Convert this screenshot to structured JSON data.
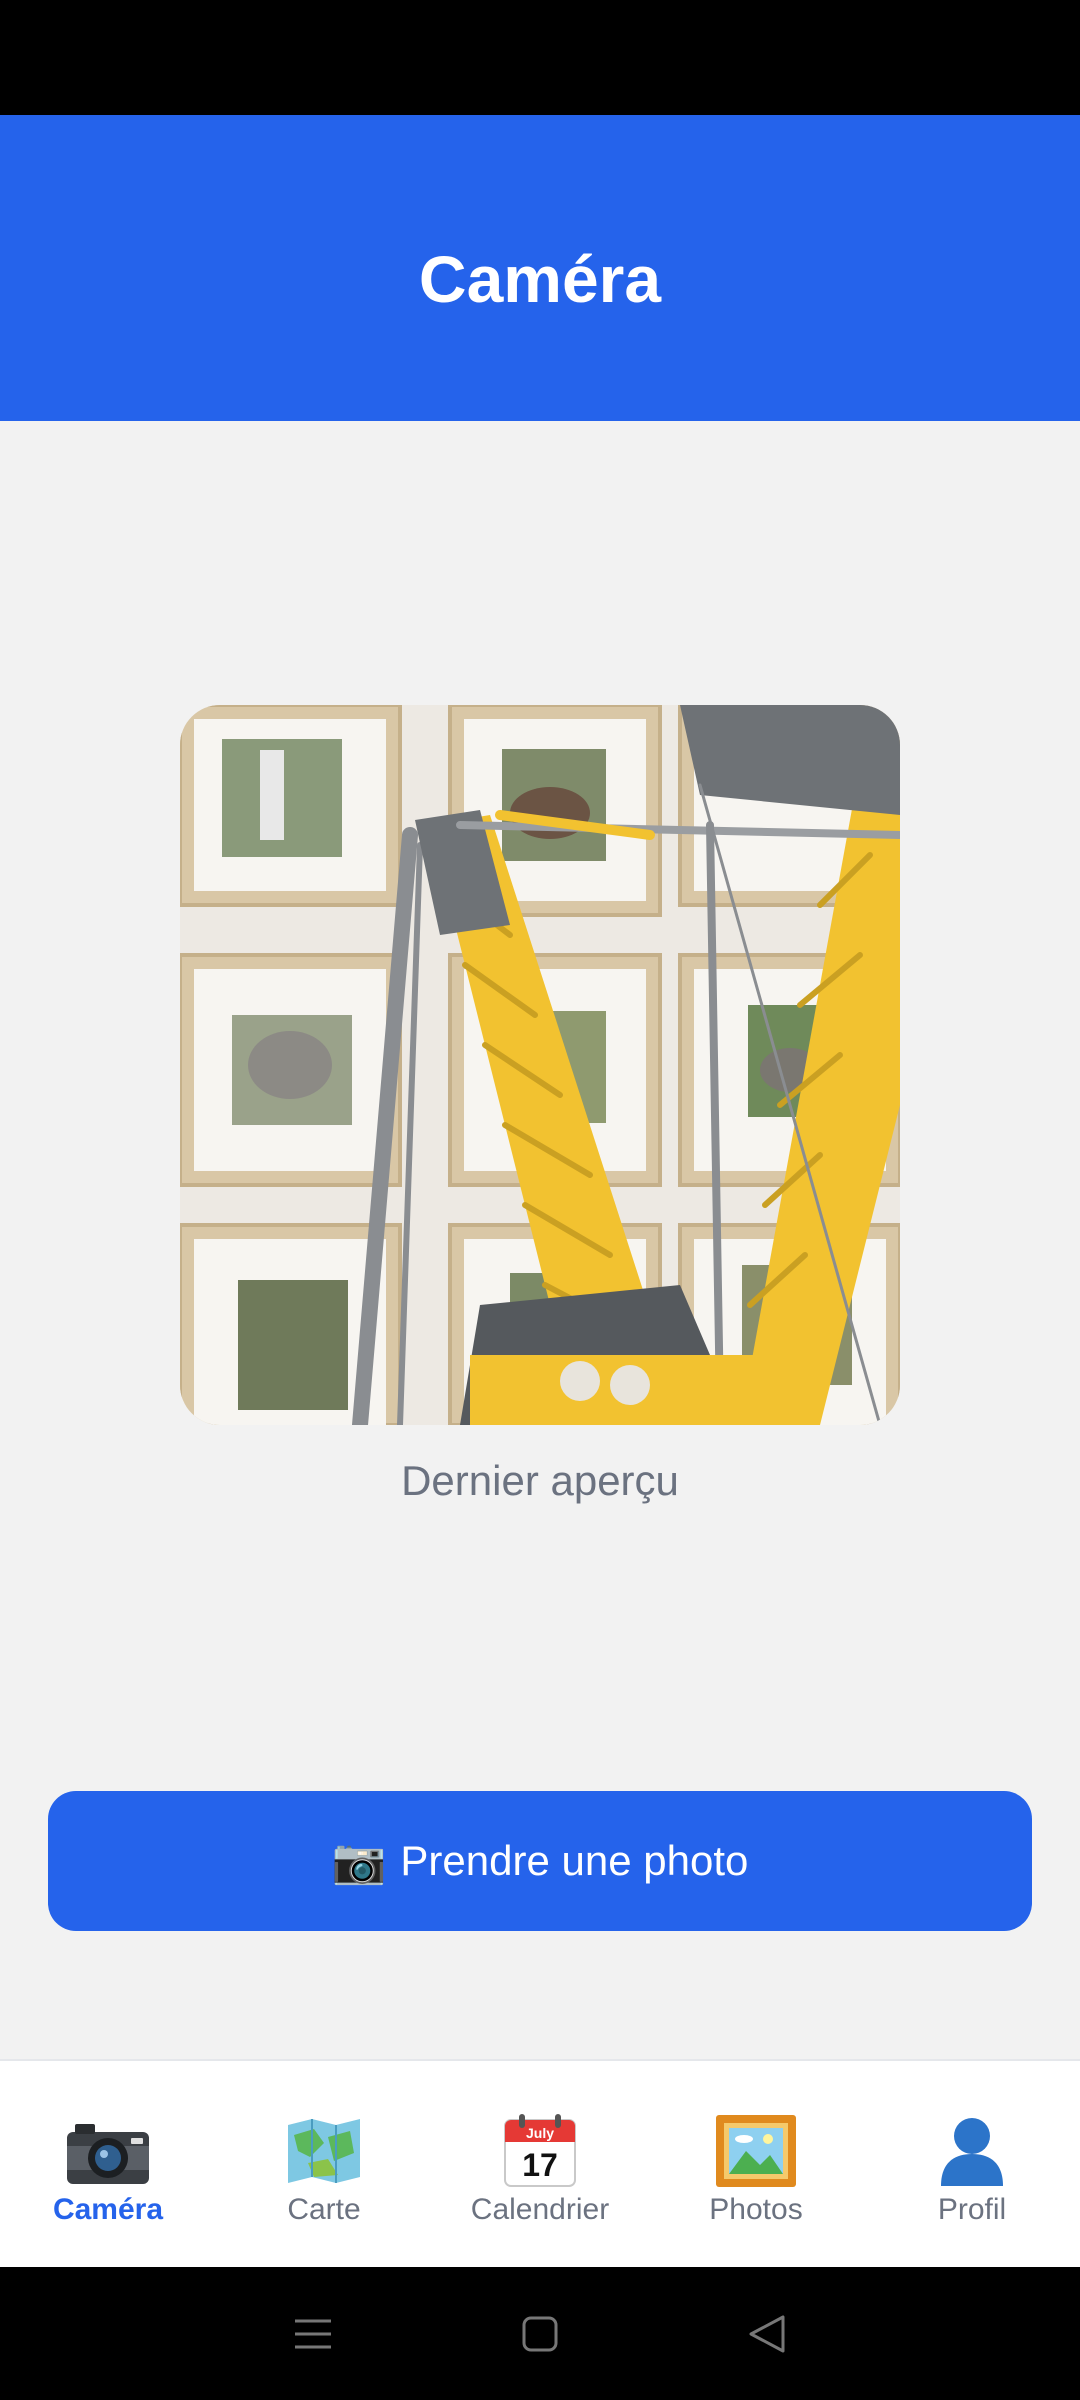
{
  "header": {
    "title": "Caméra"
  },
  "preview": {
    "caption": "Dernier aperçu",
    "image": "lego-crane-photo"
  },
  "action": {
    "icon": "📷",
    "label": "Prendre une photo"
  },
  "tabs": [
    {
      "label": "Caméra",
      "icon": "camera-icon",
      "active": true
    },
    {
      "label": "Carte",
      "icon": "map-icon",
      "active": false
    },
    {
      "label": "Calendrier",
      "icon": "calendar-icon",
      "active": false,
      "calendar": {
        "month": "July",
        "day": "17"
      }
    },
    {
      "label": "Photos",
      "icon": "framed-picture-icon",
      "active": false
    },
    {
      "label": "Profil",
      "icon": "profile-icon",
      "active": false
    }
  ],
  "colors": {
    "primary": "#2563eb",
    "background": "#f2f2f2",
    "muted": "#6b7280"
  }
}
